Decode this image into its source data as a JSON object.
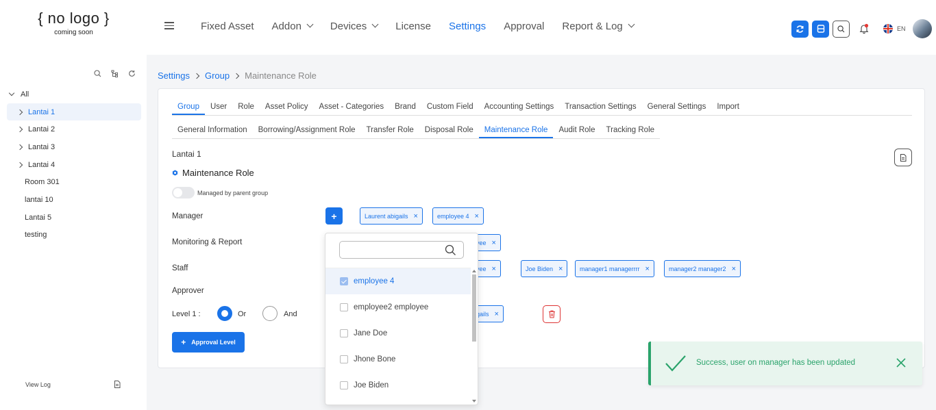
{
  "logo": {
    "main": "{ no logo }",
    "sub": "coming soon"
  },
  "nav": {
    "items": [
      {
        "label": "Fixed Asset",
        "dropdown": false,
        "active": false
      },
      {
        "label": "Addon",
        "dropdown": true,
        "active": false
      },
      {
        "label": "Devices",
        "dropdown": true,
        "active": false
      },
      {
        "label": "License",
        "dropdown": false,
        "active": false
      },
      {
        "label": "Settings",
        "dropdown": false,
        "active": true
      },
      {
        "label": "Approval",
        "dropdown": false,
        "active": false
      },
      {
        "label": "Report & Log",
        "dropdown": true,
        "active": false
      }
    ]
  },
  "header": {
    "lang": "EN",
    "icons": [
      "sync-icon",
      "list-icon",
      "search-icon",
      "bell-icon",
      "uk-flag-icon",
      "avatar"
    ]
  },
  "sidebar": {
    "root": "All",
    "items": [
      {
        "label": "Lantai 1",
        "expandable": true,
        "selected": true
      },
      {
        "label": "Lantai 2",
        "expandable": true,
        "selected": false
      },
      {
        "label": "Lantai 3",
        "expandable": true,
        "selected": false
      },
      {
        "label": "Lantai 4",
        "expandable": true,
        "selected": false
      },
      {
        "label": "Room 301",
        "expandable": false,
        "selected": false
      },
      {
        "label": "lantai 10",
        "expandable": false,
        "selected": false
      },
      {
        "label": "Lantai 5",
        "expandable": false,
        "selected": false
      },
      {
        "label": "testing",
        "expandable": false,
        "selected": false
      }
    ],
    "view_log": "View Log"
  },
  "breadcrumb": {
    "items": [
      "Settings",
      "Group"
    ],
    "current": "Maintenance Role"
  },
  "tabs1": [
    "Group",
    "User",
    "Role",
    "Asset Policy",
    "Asset - Categories",
    "Brand",
    "Custom Field",
    "Accounting Settings",
    "Transaction Settings",
    "General Settings",
    "Import"
  ],
  "tabs1_active": "Group",
  "tabs2": [
    "General Information",
    "Borrowing/Assignment Role",
    "Transfer Role",
    "Disposal Role",
    "Maintenance Role",
    "Audit Role",
    "Tracking Role"
  ],
  "tabs2_active": "Maintenance Role",
  "card": {
    "group_name": "Lantai 1",
    "role_title": "Maintenance Role",
    "toggle_label": "Managed by parent group",
    "labels": {
      "manager": "Manager",
      "monitoring": "Monitoring & Report",
      "staff": "Staff",
      "approver": "Approver",
      "level": "Level 1 :"
    },
    "radio": {
      "or": "Or",
      "and": "And",
      "selected": "Or"
    },
    "approval_button": "Approval Level",
    "manager_tags": [
      "Laurent abigails",
      "employee 4"
    ],
    "monitoring_tags": [
      "ployee"
    ],
    "staff_tags": [
      "ployee",
      "Joe Biden",
      "manager1 managerrrr",
      "manager2 manager2"
    ],
    "level_tags": [
      "abigails"
    ]
  },
  "dropdown": {
    "search_placeholder": "",
    "options": [
      {
        "label": "employee 4",
        "checked": true
      },
      {
        "label": "employee2 employee",
        "checked": false
      },
      {
        "label": "Jane Doe",
        "checked": false
      },
      {
        "label": "Jhone Bone",
        "checked": false
      },
      {
        "label": "Joe Biden",
        "checked": false
      }
    ]
  },
  "toast": {
    "message": "Success, user on manager has been updated"
  },
  "colors": {
    "primary": "#1a73e8",
    "success": "#2aa36b",
    "danger": "#dd3333"
  }
}
